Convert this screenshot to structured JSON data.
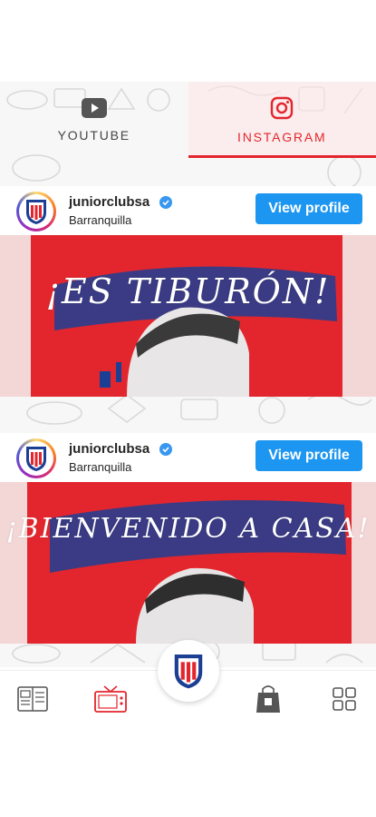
{
  "tabs": [
    {
      "label": "YOUTUBE",
      "icon": "youtube-icon",
      "active": false
    },
    {
      "label": "INSTAGRAM",
      "icon": "instagram-icon",
      "active": true
    }
  ],
  "posts": [
    {
      "username": "juniorclubsa",
      "location": "Barranquilla",
      "button_label": "View profile",
      "image_text": "¡ES TIBURÓN!"
    },
    {
      "username": "juniorclubsa",
      "location": "Barranquilla",
      "button_label": "View profile",
      "image_text": "¡BIENVENIDO A CASA!"
    }
  ],
  "bottom_nav": {
    "items": [
      {
        "icon": "news-icon"
      },
      {
        "icon": "tv-icon"
      },
      {
        "icon": "club-crest-icon"
      },
      {
        "icon": "shopping-bag-icon"
      },
      {
        "icon": "grid-menu-icon"
      }
    ]
  },
  "colors": {
    "brand_red": "#e3262d",
    "brand_blue": "#1c3f94",
    "button_blue": "#1c96f0",
    "verified_blue": "#3897f0"
  }
}
